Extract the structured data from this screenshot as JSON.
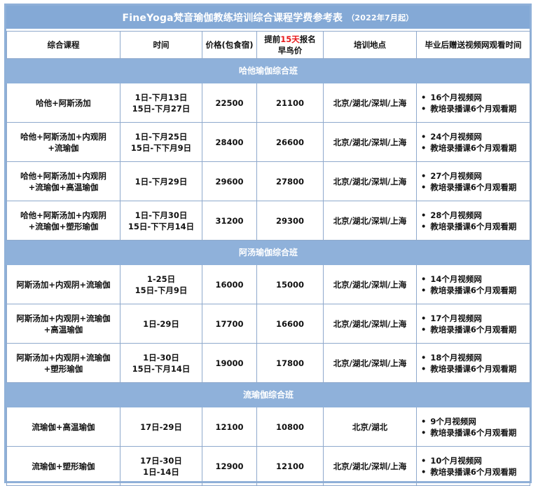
{
  "title": {
    "main": "FineYoga梵音瑜伽教练培训综合课程学费参考表",
    "sub": "（2022年7月起）"
  },
  "columns": {
    "course": "综合课程",
    "time": "时间",
    "price": "价格(包食宿)",
    "early_prefix": "提前",
    "early_highlight": "15天",
    "early_suffix": "报名",
    "early_line2": "早鸟价",
    "location": "培训地点",
    "gift": "毕业后赠送视频网观看时间"
  },
  "sections": [
    {
      "name": "哈他瑜伽综合班",
      "rows": [
        {
          "course": [
            "哈他+阿斯汤加"
          ],
          "time": [
            "1日-下月13日",
            "15日-下月27日"
          ],
          "price": "22500",
          "early": "21100",
          "location": "北京/湖北/深圳/上海",
          "gift": [
            "16个月视频网",
            "教培录播课6个月观看期"
          ]
        },
        {
          "course": [
            "哈他+阿斯汤加+内观阴",
            "+流瑜伽"
          ],
          "time": [
            "1日-下月25日",
            "15日-下下月9日"
          ],
          "price": "28400",
          "early": "26600",
          "location": "北京/湖北/深圳/上海",
          "gift": [
            "24个月视频网",
            "教培录播课6个月观看期"
          ]
        },
        {
          "course": [
            "哈他+阿斯汤加+内观阴",
            "+流瑜伽+高温瑜伽"
          ],
          "time": [
            "1日-下月29日"
          ],
          "price": "29600",
          "early": "27800",
          "location": "北京/湖北/深圳/上海",
          "gift": [
            "27个月视频网",
            "教培录播课6个月观看期"
          ]
        },
        {
          "course": [
            "哈他+阿斯汤加+内观阴",
            "+流瑜伽+塑形瑜伽"
          ],
          "time": [
            "1日-下月30日",
            "15日-下下月14日"
          ],
          "price": "31200",
          "early": "29300",
          "location": "北京/湖北/深圳/上海",
          "gift": [
            "28个月视频网",
            "教培录播课6个月观看期"
          ]
        }
      ]
    },
    {
      "name": "阿汤瑜伽综合班",
      "rows": [
        {
          "course": [
            "阿斯汤加+内观阴+流瑜伽"
          ],
          "time": [
            "1-25日",
            "15日-下月9日"
          ],
          "price": "16000",
          "early": "15000",
          "location": "北京/湖北/深圳/上海",
          "gift": [
            "14个月视频网",
            "教培录播课6个月观看期"
          ]
        },
        {
          "course": [
            "阿斯汤加+内观阴+流瑜伽",
            "+高温瑜伽"
          ],
          "time": [
            "1日-29日"
          ],
          "price": "17700",
          "early": "16600",
          "location": "北京/湖北/深圳/上海",
          "gift": [
            "17个月视频网",
            "教培录播课6个月观看期"
          ]
        },
        {
          "course": [
            "阿斯汤加+内观阴+流瑜伽",
            "+塑形瑜伽"
          ],
          "time": [
            "1日-30日",
            "15日-下月14日"
          ],
          "price": "19000",
          "early": "17800",
          "location": "北京/湖北/深圳/上海",
          "gift": [
            "18个月视频网",
            "教培录播课6个月观看期"
          ]
        }
      ]
    },
    {
      "name": "流瑜伽综合班",
      "rows": [
        {
          "course": [
            "流瑜伽+高温瑜伽"
          ],
          "time": [
            "17日-29日"
          ],
          "price": "12100",
          "early": "10800",
          "location": "北京/湖北",
          "gift": [
            "9个月视频网",
            "教培录播课6个月观看期"
          ]
        },
        {
          "course": [
            "流瑜伽+塑形瑜伽"
          ],
          "time": [
            "17日-30日",
            "1日-14日"
          ],
          "price": "12900",
          "early": "12100",
          "location": "北京/湖北/深圳/上海",
          "gift": [
            "10个月视频网",
            "教培录播课6个月观看期"
          ]
        }
      ]
    }
  ]
}
